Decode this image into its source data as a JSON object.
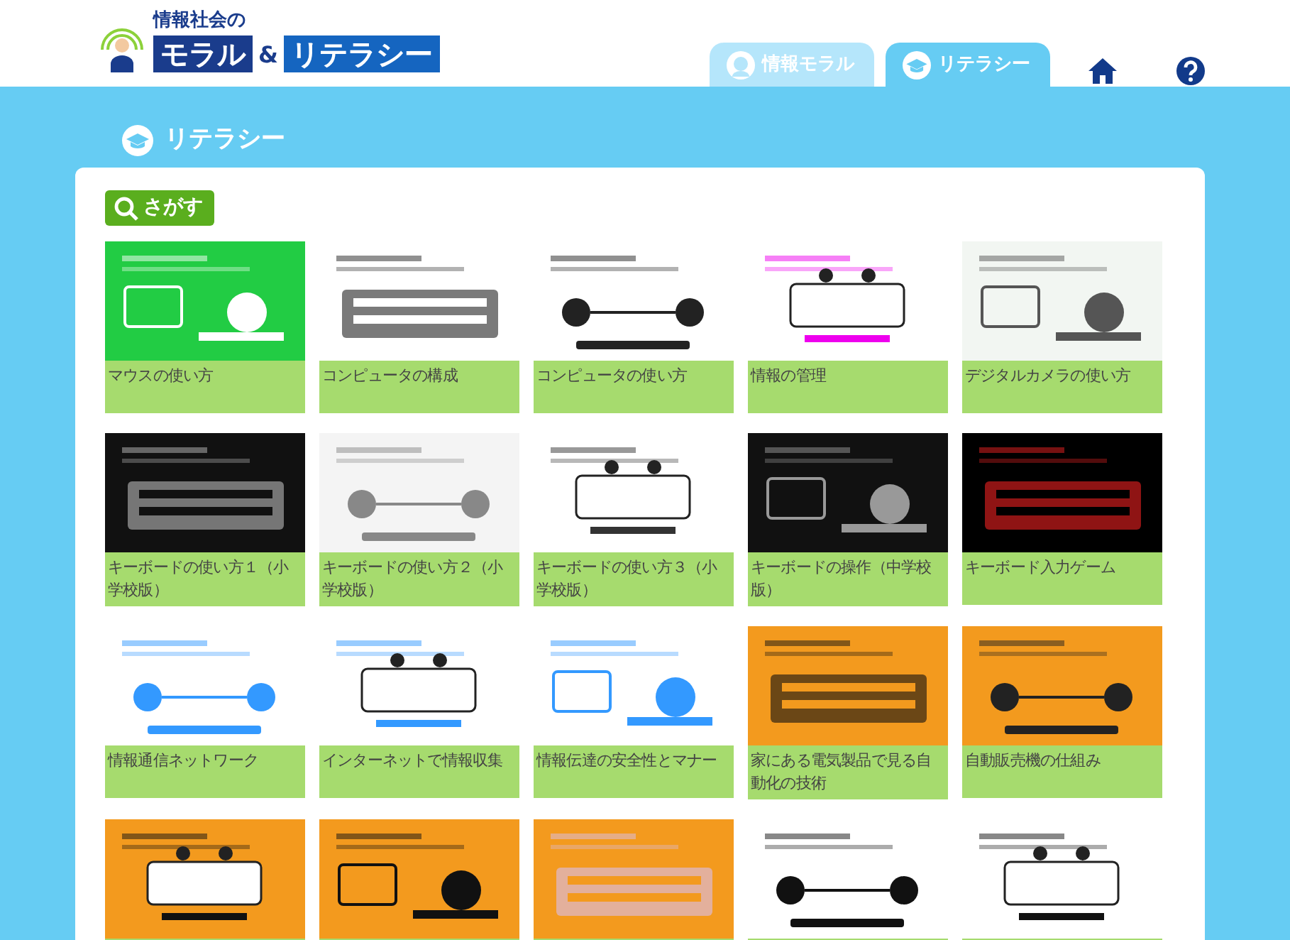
{
  "logo": {
    "top": "情報社会の",
    "left": "モラル",
    "amp": "&",
    "right": "リテラシー"
  },
  "tabs": [
    {
      "label": "情報モラル",
      "selected": false,
      "kind": "face"
    },
    {
      "label": "リテラシー",
      "selected": true,
      "kind": "cap"
    }
  ],
  "section_title": "リテラシー",
  "search_button": "さがす",
  "items": [
    {
      "thumbnail": {
        "kind": "picture"
      },
      "title": "マウスの使い方"
    },
    {
      "thumbnail": {
        "kind": "picture"
      },
      "title": "コンピュータの構成"
    },
    {
      "thumbnail": {
        "kind": "picture"
      },
      "title": "コンピュータの使い方"
    },
    {
      "thumbnail": {
        "kind": "picture"
      },
      "title": "情報の管理"
    },
    {
      "thumbnail": {
        "kind": "picture"
      },
      "title": "デジタルカメラの使い方"
    },
    {
      "thumbnail": {
        "kind": "picture"
      },
      "title": "キーボードの使い方１（小学校版）"
    },
    {
      "thumbnail": {
        "kind": "picture"
      },
      "title": "キーボードの使い方２（小学校版）"
    },
    {
      "thumbnail": {
        "kind": "picture"
      },
      "title": "キーボードの使い方３（小学校版）"
    },
    {
      "thumbnail": {
        "kind": "picture"
      },
      "title": "キーボードの操作（中学校版）"
    },
    {
      "thumbnail": {
        "kind": "picture"
      },
      "title": "キーボード入力ゲーム"
    },
    {
      "thumbnail": {
        "kind": "picture"
      },
      "title": "情報通信ネットワーク"
    },
    {
      "thumbnail": {
        "kind": "picture"
      },
      "title": "インターネットで情報収集"
    },
    {
      "thumbnail": {
        "kind": "picture"
      },
      "title": "情報伝達の安全性とマナー"
    },
    {
      "thumbnail": {
        "kind": "picture"
      },
      "title": "家にある電気製品で見る自動化の技術"
    },
    {
      "thumbnail": {
        "kind": "picture"
      },
      "title": "自動販売機の仕組み"
    },
    {
      "thumbnail": {
        "kind": "picture"
      }
    },
    {
      "thumbnail": {
        "kind": "picture"
      }
    },
    {
      "thumbnail": {
        "kind": "picture"
      }
    },
    {
      "thumbnail": {
        "kind": "picture"
      }
    },
    {
      "thumbnail": {
        "kind": "picture"
      }
    }
  ]
}
